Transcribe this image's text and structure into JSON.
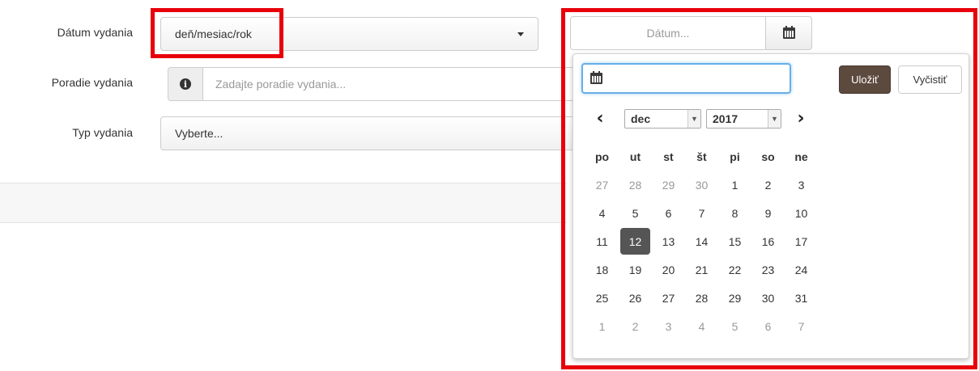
{
  "form": {
    "date_label": "Dátum vydania",
    "date_select_value": "deň/mesiac/rok",
    "order_label": "Poradie vydania",
    "order_placeholder": "Zadajte poradie vydania...",
    "type_label": "Typ vydania",
    "type_select_value": "Vyberte..."
  },
  "datepicker": {
    "input_placeholder": "Dátum...",
    "popup_input_value": "",
    "save_label": "Uložiť",
    "clear_label": "Vyčistiť",
    "month": "dec",
    "year": "2017",
    "weekdays": [
      "po",
      "ut",
      "st",
      "št",
      "pi",
      "so",
      "ne"
    ],
    "weeks": [
      [
        {
          "d": "27",
          "muted": true
        },
        {
          "d": "28",
          "muted": true
        },
        {
          "d": "29",
          "muted": true
        },
        {
          "d": "30",
          "muted": true
        },
        {
          "d": "1"
        },
        {
          "d": "2"
        },
        {
          "d": "3"
        }
      ],
      [
        {
          "d": "4"
        },
        {
          "d": "5"
        },
        {
          "d": "6"
        },
        {
          "d": "7"
        },
        {
          "d": "8"
        },
        {
          "d": "9"
        },
        {
          "d": "10"
        }
      ],
      [
        {
          "d": "11"
        },
        {
          "d": "12",
          "selected": true
        },
        {
          "d": "13"
        },
        {
          "d": "14"
        },
        {
          "d": "15"
        },
        {
          "d": "16"
        },
        {
          "d": "17"
        }
      ],
      [
        {
          "d": "18"
        },
        {
          "d": "19"
        },
        {
          "d": "20"
        },
        {
          "d": "21"
        },
        {
          "d": "22"
        },
        {
          "d": "23"
        },
        {
          "d": "24"
        }
      ],
      [
        {
          "d": "25"
        },
        {
          "d": "26"
        },
        {
          "d": "27"
        },
        {
          "d": "28"
        },
        {
          "d": "29"
        },
        {
          "d": "30"
        },
        {
          "d": "31"
        }
      ],
      [
        {
          "d": "1",
          "muted": true
        },
        {
          "d": "2",
          "muted": true
        },
        {
          "d": "3",
          "muted": true
        },
        {
          "d": "4",
          "muted": true
        },
        {
          "d": "5",
          "muted": true
        },
        {
          "d": "6",
          "muted": true
        },
        {
          "d": "7",
          "muted": true
        }
      ]
    ]
  },
  "colors": {
    "highlight": "#e8000b",
    "save_button": "#5d4a3f",
    "selected_day": "#555555",
    "focus_border": "#66afe9"
  }
}
